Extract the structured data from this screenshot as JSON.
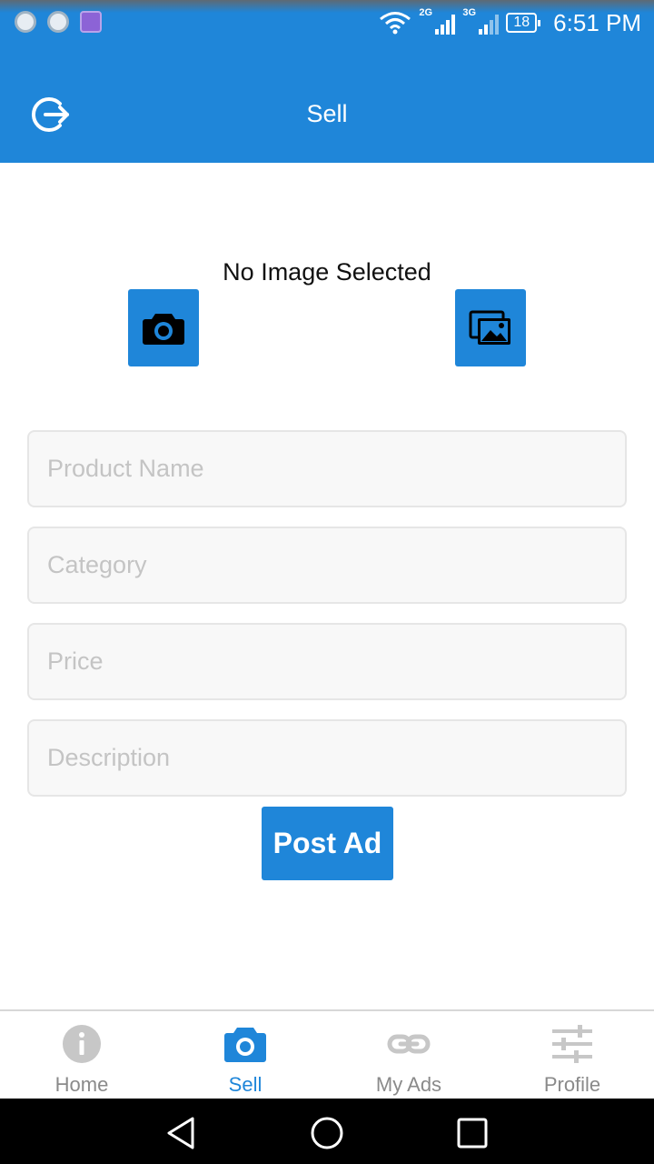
{
  "status_bar": {
    "net1": "2G",
    "net2": "3G",
    "battery": "18",
    "time": "6:51 PM"
  },
  "header": {
    "title": "Sell",
    "logout_icon": "logout-icon"
  },
  "image_picker": {
    "status_text": "No Image Selected",
    "camera_icon": "camera-icon",
    "gallery_icon": "gallery-icon"
  },
  "form": {
    "product_name_placeholder": "Product Name",
    "category_placeholder": "Category",
    "price_placeholder": "Price",
    "description_placeholder": "Description",
    "submit_label": "Post Ad"
  },
  "tabs": [
    {
      "label": "Home",
      "icon": "info-icon",
      "active": false
    },
    {
      "label": "Sell",
      "icon": "camera-icon",
      "active": true
    },
    {
      "label": "My Ads",
      "icon": "link-icon",
      "active": false
    },
    {
      "label": "Profile",
      "icon": "sliders-icon",
      "active": false
    }
  ],
  "colors": {
    "primary": "#1f86d9",
    "inactive_tab": "#8a8a8a",
    "field_bg": "#f8f8f8",
    "placeholder": "#c4c4c4"
  }
}
